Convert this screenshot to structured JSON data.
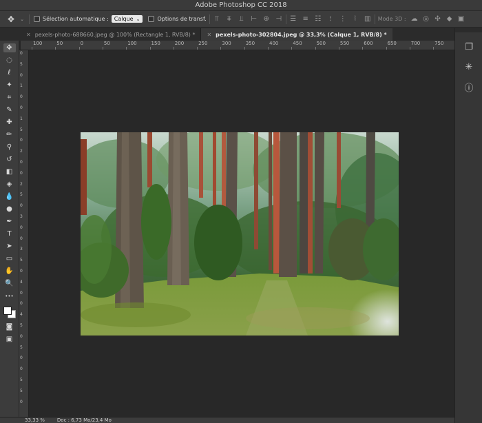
{
  "app": {
    "title": "Adobe Photoshop CC 2018"
  },
  "options_bar": {
    "auto_select_label": "Sélection automatique :",
    "auto_select_value": "Calque",
    "transform_label": "Options de transf.",
    "mode3d_label": "Mode 3D :"
  },
  "tabs": [
    {
      "label": "pexels-photo-688660.jpeg @ 100% (Rectangle 1, RVB/8) *",
      "active": false
    },
    {
      "label": "pexels-photo-302804.jpeg @ 33,3% (Calque 1, RVB/8) *",
      "active": true
    }
  ],
  "ruler_top": [
    "100",
    "50",
    "0",
    "50",
    "100",
    "150",
    "200",
    "250",
    "300",
    "350",
    "400",
    "450",
    "500",
    "550",
    "600",
    "650",
    "700",
    "750"
  ],
  "ruler_left": [
    "0",
    "5",
    "0",
    "1",
    "0",
    "0",
    "1",
    "5",
    "0",
    "2",
    "0",
    "0",
    "2",
    "5",
    "0",
    "3",
    "0",
    "0",
    "3",
    "5",
    "0",
    "4",
    "0",
    "0",
    "4",
    "5",
    "0",
    "5",
    "0",
    "0",
    "5",
    "5",
    "0"
  ],
  "tools": [
    "move-icon",
    "marquee-icon",
    "lasso-icon",
    "magic-wand-icon",
    "crop-icon",
    "eyedropper-icon",
    "healing-brush-icon",
    "brush-icon",
    "clone-stamp-icon",
    "history-brush-icon",
    "eraser-icon",
    "paint-bucket-icon",
    "blur-icon",
    "dodge-icon",
    "pen-icon",
    "type-icon",
    "path-selection-icon",
    "rectangle-icon",
    "hand-icon",
    "zoom-icon",
    "more-tools-icon"
  ],
  "tool_glyphs": [
    "✥",
    "◌",
    "ℓ",
    "✦",
    "⌗",
    "✎",
    "✚",
    "✏",
    "⚲",
    "↺",
    "◧",
    "◈",
    "💧",
    "●",
    "✒",
    "T",
    "➤",
    "▭",
    "✋",
    "🔍",
    "•••"
  ],
  "right_panel": [
    "history-panel-icon",
    "brush-settings-icon",
    "info-panel-icon"
  ],
  "right_glyphs": [
    "❐",
    "✳",
    "ⓘ"
  ],
  "status": {
    "zoom": "33,33 %",
    "doc": "Doc : 6,73 Mo/23,4 Mo"
  },
  "colors": {
    "fg": "#ffffff",
    "bg": "#ffffff",
    "ui_dark": "#262626",
    "ui_panel": "#3c3c3c"
  }
}
